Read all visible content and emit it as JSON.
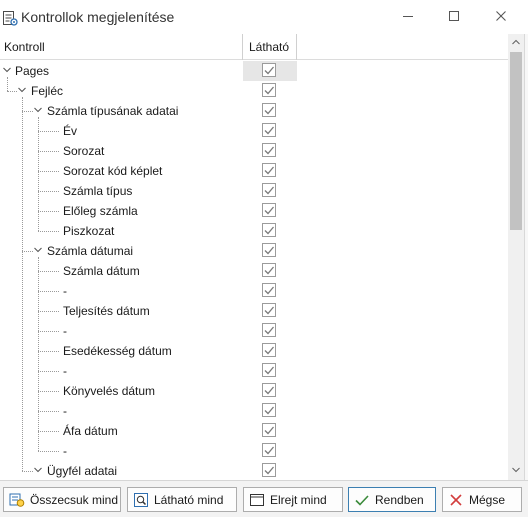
{
  "window": {
    "title": "Kontrollok megjelenítése",
    "icon": "form-settings-icon",
    "controls": {
      "minimize_icon": "minimize-icon",
      "maximize_icon": "maximize-icon",
      "close_icon": "close-icon"
    }
  },
  "grid": {
    "columns": [
      "Kontroll",
      "Látható"
    ],
    "rows": [
      {
        "label": "Pages",
        "level": 0,
        "expanded": true,
        "visible": true
      },
      {
        "label": "Fejléc",
        "level": 1,
        "expanded": true,
        "visible": true
      },
      {
        "label": "Számla típusának adatai",
        "level": 2,
        "expanded": true,
        "visible": true
      },
      {
        "label": "Év",
        "level": 3,
        "visible": true
      },
      {
        "label": "Sorozat",
        "level": 3,
        "visible": true
      },
      {
        "label": "Sorozat kód képlet",
        "level": 3,
        "visible": true
      },
      {
        "label": "Számla típus",
        "level": 3,
        "visible": true
      },
      {
        "label": "Előleg számla",
        "level": 3,
        "visible": true
      },
      {
        "label": "Piszkozat",
        "level": 3,
        "visible": true
      },
      {
        "label": "Számla dátumai",
        "level": 2,
        "expanded": true,
        "visible": true
      },
      {
        "label": "Számla dátum",
        "level": 3,
        "visible": true
      },
      {
        "label": "-",
        "level": 3,
        "visible": true
      },
      {
        "label": "Teljesítés dátum",
        "level": 3,
        "visible": true
      },
      {
        "label": "-",
        "level": 3,
        "visible": true
      },
      {
        "label": "Esedékesség dátum",
        "level": 3,
        "visible": true
      },
      {
        "label": "-",
        "level": 3,
        "visible": true
      },
      {
        "label": "Könyvelés dátum",
        "level": 3,
        "visible": true
      },
      {
        "label": "-",
        "level": 3,
        "visible": true
      },
      {
        "label": "Áfa dátum",
        "level": 3,
        "visible": true
      },
      {
        "label": "-",
        "level": 3,
        "visible": true
      },
      {
        "label": "Ügyfél adatai",
        "level": 2,
        "expanded": true,
        "visible": true
      }
    ]
  },
  "buttons": {
    "collapse_all": "Összecsuk mind",
    "show_all": "Látható mind",
    "hide_all": "Elrejt mind",
    "ok": "Rendben",
    "cancel": "Mégse"
  },
  "colors": {
    "accent": "#3c7fb1",
    "check": "#7a7a7a",
    "cancel_x": "#d23c3c",
    "ok_check": "#3a8a3a"
  }
}
